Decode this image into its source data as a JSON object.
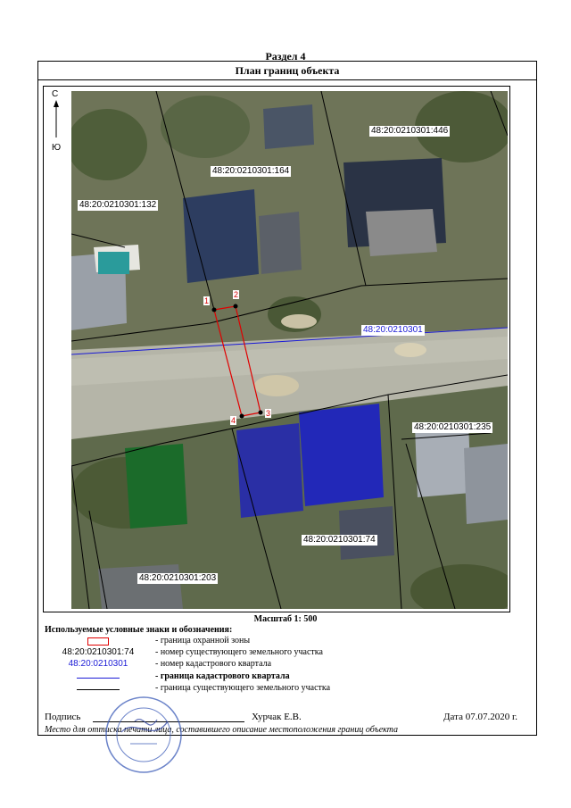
{
  "section": "Раздел 4",
  "plan_title": "План границ объекта",
  "compass": {
    "north": "С",
    "south": "Ю"
  },
  "map": {
    "parcels": [
      {
        "id": "48:20:0210301:446"
      },
      {
        "id": "48:20:0210301:164"
      },
      {
        "id": "48:20:0210301:132"
      },
      {
        "id": "48:20:0210301:235"
      },
      {
        "id": "48:20:0210301:74"
      },
      {
        "id": "48:20:0210301:203"
      }
    ],
    "quarter": "48:20:0210301",
    "points": [
      "1",
      "2",
      "3",
      "4"
    ]
  },
  "scale": "Масштаб 1: 500",
  "legend": {
    "title": "Используемые условные знаки и обозначения:",
    "items": [
      {
        "sample": "",
        "desc": "- граница  охранной зоны"
      },
      {
        "sample": "48:20:0210301:74",
        "desc": "- номер существующего земельного участка"
      },
      {
        "sample": "48:20:0210301",
        "desc": "- номер кадастрового квартала"
      },
      {
        "sample": "",
        "desc": "- граница кадастрового квартала"
      },
      {
        "sample": "",
        "desc": "- граница существующего земельного участка"
      }
    ]
  },
  "signature": {
    "label": "Подпись",
    "name": "Хурчак Е.В.",
    "date": "Дата 07.07.2020 г."
  },
  "stamp_note": "Место для оттиска печати лица, составившего описание местоположения границ объекта",
  "colors": {
    "zone_border": "#e00000",
    "quarter_border": "#1a1ad6",
    "parcel_border": "#000000"
  }
}
